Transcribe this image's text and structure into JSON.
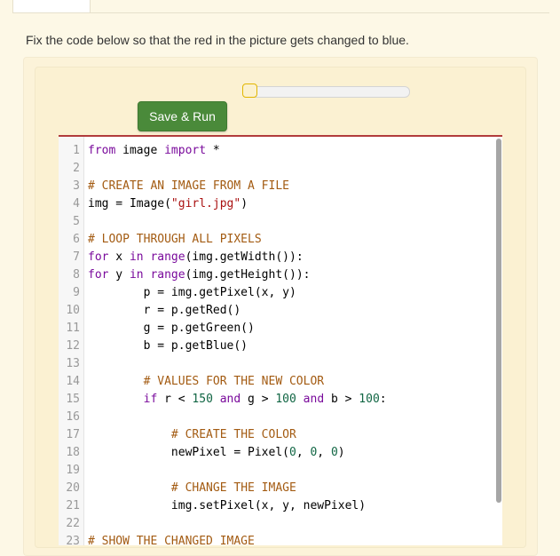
{
  "prompt": "Fix the code below so that the red in the picture gets changed to blue.",
  "run_button": "Save & Run",
  "code_lines": [
    {
      "n": "1",
      "code": "from image import *"
    },
    {
      "n": "2",
      "code": ""
    },
    {
      "n": "3",
      "code": "# CREATE AN IMAGE FROM A FILE"
    },
    {
      "n": "4",
      "code": "img = Image(\"girl.jpg\")"
    },
    {
      "n": "5",
      "code": ""
    },
    {
      "n": "6",
      "code": "# LOOP THROUGH ALL PIXELS"
    },
    {
      "n": "7",
      "code": "for x in range(img.getWidth()):"
    },
    {
      "n": "8",
      "code": "for y in range(img.getHeight()):"
    },
    {
      "n": "9",
      "code": "        p = img.getPixel(x, y)"
    },
    {
      "n": "10",
      "code": "        r = p.getRed()"
    },
    {
      "n": "11",
      "code": "        g = p.getGreen()"
    },
    {
      "n": "12",
      "code": "        b = p.getBlue()"
    },
    {
      "n": "13",
      "code": ""
    },
    {
      "n": "14",
      "code": "        # VALUES FOR THE NEW COLOR"
    },
    {
      "n": "15",
      "code": "        if r < 150 and g > 100 and b > 100:"
    },
    {
      "n": "16",
      "code": ""
    },
    {
      "n": "17",
      "code": "            # CREATE THE COLOR"
    },
    {
      "n": "18",
      "code": "            newPixel = Pixel(0, 0, 0)"
    },
    {
      "n": "19",
      "code": ""
    },
    {
      "n": "20",
      "code": "            # CHANGE THE IMAGE"
    },
    {
      "n": "21",
      "code": "            img.setPixel(x, y, newPixel)"
    },
    {
      "n": "22",
      "code": ""
    },
    {
      "n": "23",
      "code": "# SHOW THE CHANGED IMAGE"
    }
  ],
  "colors": {
    "run_button_bg": "#4a8a3a",
    "editor_top_border": "#b13c3c",
    "keyword": "#7a0b9c",
    "comment": "#a35b12"
  },
  "icons": {
    "slider_handle": "slider-handle-icon"
  }
}
